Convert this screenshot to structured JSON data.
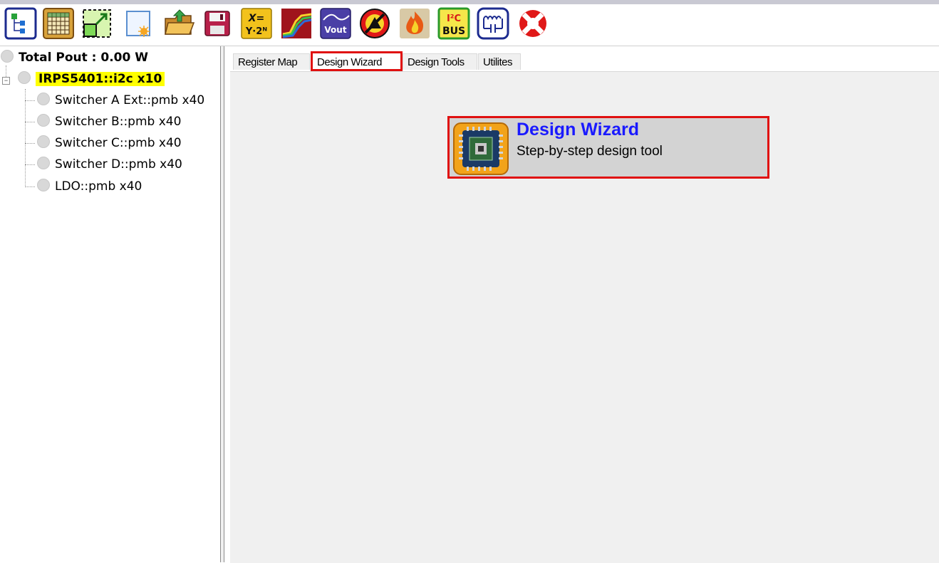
{
  "toolbar": {
    "buttons": [
      {
        "name": "tree-view-icon"
      },
      {
        "name": "register-grid-icon"
      },
      {
        "name": "resize-icon"
      },
      {
        "name": "new-file-icon"
      },
      {
        "name": "open-folder-icon"
      },
      {
        "name": "save-disk-icon"
      },
      {
        "name": "formula-icon",
        "text_top": "X=",
        "text_bottom": "Y·2ᴺ"
      },
      {
        "name": "waveform-icon"
      },
      {
        "name": "vout-icon",
        "text": "Vout"
      },
      {
        "name": "no-fault-icon"
      },
      {
        "name": "thermal-fire-icon"
      },
      {
        "name": "i2c-bus-icon",
        "text_top": "I²C",
        "text_bottom": "BUS"
      },
      {
        "name": "circuit-icon"
      },
      {
        "name": "help-lifebuoy-icon"
      }
    ]
  },
  "tree": {
    "total_pout": "Total Pout : 0.00 W",
    "device": "IRPS5401::i2c x10",
    "children": [
      "Switcher A Ext::pmb x40",
      "Switcher B::pmb x40",
      "Switcher C::pmb x40",
      "Switcher D::pmb x40",
      "LDO::pmb x40"
    ]
  },
  "tabs": [
    {
      "label": "Register Map",
      "active": false
    },
    {
      "label": "Design Wizard",
      "active": true
    },
    {
      "label": "Design Tools",
      "active": false
    },
    {
      "label": "Utilites",
      "active": false
    }
  ],
  "design_wizard": {
    "title": "Design Wizard",
    "subtitle": "Step-by-step design tool"
  },
  "colors": {
    "highlight_red": "#e01010",
    "title_blue": "#1a1aff",
    "device_highlight": "#ffff00"
  }
}
